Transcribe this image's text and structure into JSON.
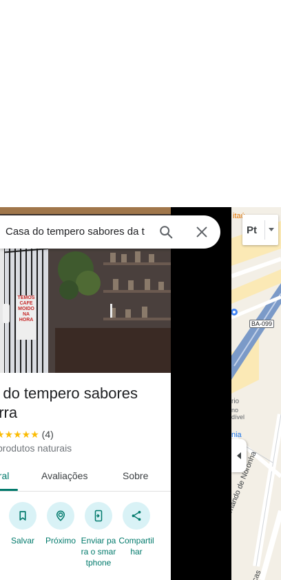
{
  "search": {
    "value": "Casa do tempero sabores da t"
  },
  "layer_button": {
    "label": "Pt"
  },
  "place": {
    "title": "a do tempero sabores\nerra",
    "stars": "★★★★★",
    "review_count": "(4)",
    "category": "produtos naturais"
  },
  "tabs": [
    {
      "label": "eral"
    },
    {
      "label": "Avaliações"
    },
    {
      "label": "Sobre"
    }
  ],
  "actions": [
    {
      "label": "Salvar",
      "icon": "bookmark-icon"
    },
    {
      "label": "Próximo",
      "icon": "nearby-icon"
    },
    {
      "label": "Enviar para o smartphone",
      "icon": "send-to-phone-icon"
    },
    {
      "label": "Compartilhar",
      "icon": "share-icon"
    }
  ],
  "photo_sign": "TEMOS\nCAFE\nMOIDO\nNA HORA",
  "map": {
    "road_badge": "BA-099",
    "street_label": "rnando de Noronha",
    "poi_label_1": "rio",
    "poi_label_2": "no",
    "poi_label_3": "dível",
    "poi_label_4": "nia",
    "poi_label_5": "cas",
    "poi_label_6": "itaú"
  },
  "colors": {
    "accent": "#00796b",
    "action_bg": "#d9f2f6",
    "star": "#fbbc04"
  }
}
